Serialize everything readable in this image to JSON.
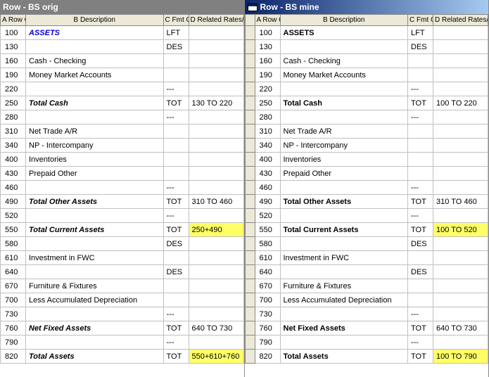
{
  "left": {
    "title": "Row - BS orig",
    "headers": {
      "sel": "",
      "a": "A\nRow\nCode",
      "b": "B\nDescription",
      "c": "C\nFmt\nCode",
      "d": "D\nRelated\nRates/Rows/\nUnit"
    },
    "rows": [
      {
        "code": "100",
        "desc": "ASSETS",
        "fmt": "LFT",
        "rel": "",
        "style": "bold italic blue"
      },
      {
        "code": "130",
        "desc": "",
        "fmt": "DES",
        "rel": ""
      },
      {
        "code": "160",
        "desc": "Cash - Checking",
        "fmt": "",
        "rel": ""
      },
      {
        "code": "190",
        "desc": "Money Market Accounts",
        "fmt": "",
        "rel": ""
      },
      {
        "code": "220",
        "desc": "",
        "fmt": "---",
        "rel": ""
      },
      {
        "code": "250",
        "desc": "Total Cash",
        "fmt": "TOT",
        "rel": "130 TO 220",
        "style": "bold italic"
      },
      {
        "code": "280",
        "desc": "",
        "fmt": "---",
        "rel": ""
      },
      {
        "code": "310",
        "desc": "Net Trade A/R",
        "fmt": "",
        "rel": ""
      },
      {
        "code": "340",
        "desc": "NP - Intercompany",
        "fmt": "",
        "rel": ""
      },
      {
        "code": "400",
        "desc": "Inventories",
        "fmt": "",
        "rel": ""
      },
      {
        "code": "430",
        "desc": "Prepaid Other",
        "fmt": "",
        "rel": ""
      },
      {
        "code": "460",
        "desc": "",
        "fmt": "---",
        "rel": ""
      },
      {
        "code": "490",
        "desc": "Total Other Assets",
        "fmt": "TOT",
        "rel": "310 TO 460",
        "style": "bold italic"
      },
      {
        "code": "520",
        "desc": "",
        "fmt": "---",
        "rel": ""
      },
      {
        "code": "550",
        "desc": "Total Current Assets",
        "fmt": "TOT",
        "rel": "250+490",
        "style": "bold italic",
        "hl": true
      },
      {
        "code": "580",
        "desc": "",
        "fmt": "DES",
        "rel": ""
      },
      {
        "code": "610",
        "desc": "Investment in FWC",
        "fmt": "",
        "rel": ""
      },
      {
        "code": "640",
        "desc": "",
        "fmt": "DES",
        "rel": ""
      },
      {
        "code": "670",
        "desc": "Furniture & Fixtures",
        "fmt": "",
        "rel": ""
      },
      {
        "code": "700",
        "desc": "Less Accumulated Depreciation",
        "fmt": "",
        "rel": ""
      },
      {
        "code": "730",
        "desc": "",
        "fmt": "---",
        "rel": ""
      },
      {
        "code": "760",
        "desc": "Net Fixed Assets",
        "fmt": "TOT",
        "rel": "640 TO 730",
        "style": "bold italic"
      },
      {
        "code": "790",
        "desc": "",
        "fmt": "---",
        "rel": ""
      },
      {
        "code": "820",
        "desc": "Total Assets",
        "fmt": "TOT",
        "rel": "550+610+760",
        "style": "bold italic",
        "hl": true
      }
    ]
  },
  "right": {
    "title": "Row - BS mine",
    "headers": {
      "sel": "",
      "a": "A\nRow\nCode",
      "b": "B\nDescription",
      "c": "C\nFmt\nCode",
      "d": "D\nRelated\nRates/Rows/\nUnit"
    },
    "rows": [
      {
        "code": "100",
        "desc": "ASSETS",
        "fmt": "LFT",
        "rel": "",
        "style": "bold"
      },
      {
        "code": "130",
        "desc": "",
        "fmt": "DES",
        "rel": ""
      },
      {
        "code": "160",
        "desc": "Cash - Checking",
        "fmt": "",
        "rel": ""
      },
      {
        "code": "190",
        "desc": "Money Market Accounts",
        "fmt": "",
        "rel": ""
      },
      {
        "code": "220",
        "desc": "",
        "fmt": "---",
        "rel": ""
      },
      {
        "code": "250",
        "desc": "Total Cash",
        "fmt": "TOT",
        "rel": "100 TO 220",
        "style": "bold"
      },
      {
        "code": "280",
        "desc": "",
        "fmt": "---",
        "rel": ""
      },
      {
        "code": "310",
        "desc": "Net Trade A/R",
        "fmt": "",
        "rel": ""
      },
      {
        "code": "340",
        "desc": "NP - Intercompany",
        "fmt": "",
        "rel": ""
      },
      {
        "code": "400",
        "desc": "Inventories",
        "fmt": "",
        "rel": ""
      },
      {
        "code": "430",
        "desc": "Prepaid Other",
        "fmt": "",
        "rel": ""
      },
      {
        "code": "460",
        "desc": "",
        "fmt": "---",
        "rel": ""
      },
      {
        "code": "490",
        "desc": "Total Other Assets",
        "fmt": "TOT",
        "rel": "310 TO 460",
        "style": "bold"
      },
      {
        "code": "520",
        "desc": "",
        "fmt": "---",
        "rel": ""
      },
      {
        "code": "550",
        "desc": "Total Current Assets",
        "fmt": "TOT",
        "rel": "100 TO 520",
        "style": "bold",
        "hl": true
      },
      {
        "code": "580",
        "desc": "",
        "fmt": "DES",
        "rel": ""
      },
      {
        "code": "610",
        "desc": "Investment in FWC",
        "fmt": "",
        "rel": ""
      },
      {
        "code": "640",
        "desc": "",
        "fmt": "DES",
        "rel": ""
      },
      {
        "code": "670",
        "desc": "Furniture & Fixtures",
        "fmt": "",
        "rel": ""
      },
      {
        "code": "700",
        "desc": "Less Accumulated Depreciation",
        "fmt": "",
        "rel": ""
      },
      {
        "code": "730",
        "desc": "",
        "fmt": "---",
        "rel": ""
      },
      {
        "code": "760",
        "desc": "Net Fixed Assets",
        "fmt": "TOT",
        "rel": "640 TO 730",
        "style": "bold"
      },
      {
        "code": "790",
        "desc": "",
        "fmt": "---",
        "rel": ""
      },
      {
        "code": "820",
        "desc": "Total Assets",
        "fmt": "TOT",
        "rel": "100 TO 790",
        "style": "bold",
        "hl": true
      }
    ]
  }
}
